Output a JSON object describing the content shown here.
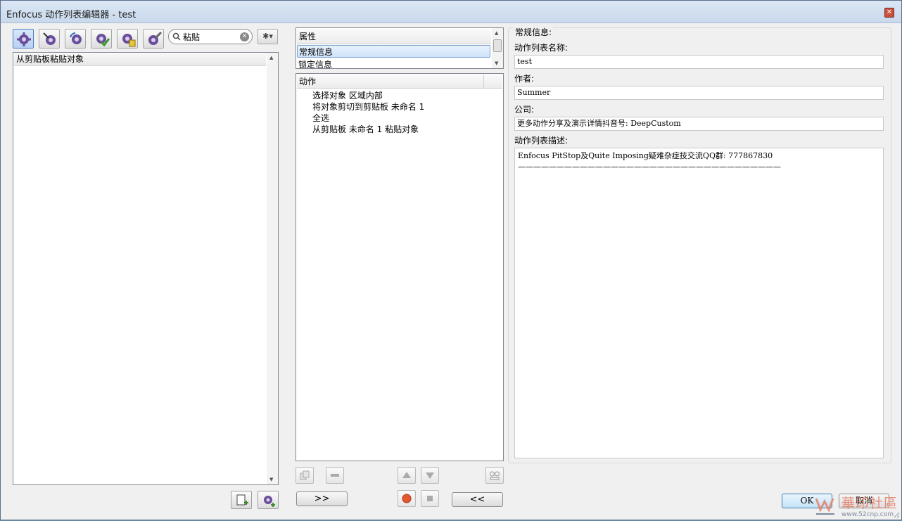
{
  "window": {
    "title": "Enfocus 动作列表编辑器 - test",
    "close_symbol": "✕"
  },
  "left": {
    "search": {
      "value": "粘贴",
      "clear_symbol": "✕"
    },
    "gear_menu_label": "✱▾",
    "list_items": [
      "从剪贴板粘贴对象"
    ],
    "scroll_up": "▲",
    "scroll_down": "▼"
  },
  "middle": {
    "properties": {
      "header": "属性",
      "items": [
        "常规信息",
        "锁定信息"
      ],
      "scroll_up": "▲",
      "scroll_down": "▼"
    },
    "actions": {
      "header": "动作",
      "items": [
        "选择对象 区域内部",
        "将对象剪切到剪贴板 未命名 1",
        "全选",
        "从剪贴板 未命名 1 粘贴对象"
      ]
    },
    "forward_button": ">>",
    "back_button": "<<"
  },
  "right": {
    "group_title": "常规信息:",
    "name_label": "动作列表名称:",
    "name_value": "test",
    "author_label": "作者:",
    "author_value": "Summer",
    "company_label": "公司:",
    "company_value": "更多动作分享及演示详情抖音号: DeepCustom",
    "description_label": "动作列表描述:",
    "description_lines": [
      "Enfocus PitStop及Quite Imposing疑难杂症技交流QQ群: 777867830",
      "——————————————————————————————————"
    ]
  },
  "footer": {
    "ok_label": "OK",
    "cancel_label": "取消"
  },
  "watermark": {
    "text": "華印社區",
    "url": "www.52cnp.com"
  },
  "colors": {
    "accent": "#4d7fbf",
    "gear_purple": "#6b4e9b",
    "record_red": "#e4572e"
  }
}
